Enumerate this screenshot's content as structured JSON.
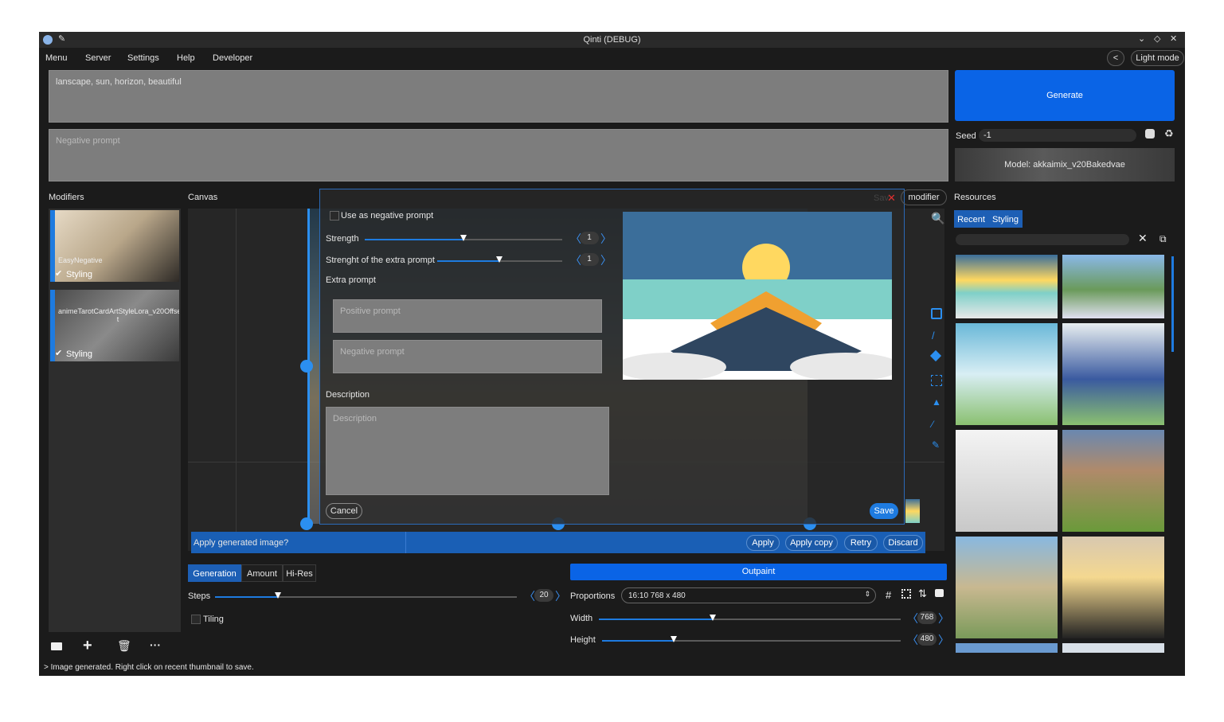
{
  "window": {
    "title": "Qinti (DEBUG)"
  },
  "menu": {
    "items": [
      "Menu",
      "Server",
      "Settings",
      "Help",
      "Developer"
    ],
    "back_label": "<",
    "mode_label": "Light mode"
  },
  "prompt": {
    "value": "lanscape, sun, horizon, beautiful",
    "negative_placeholder": "Negative prompt"
  },
  "generate": {
    "label": "Generate"
  },
  "seed": {
    "label": "Seed",
    "value": "-1"
  },
  "model": {
    "label": "Model: akkaimix_v20Bakedvae"
  },
  "sections": {
    "modifiers": "Modifiers",
    "canvas": "Canvas",
    "resources": "Resources"
  },
  "modifiers": [
    {
      "name": "EasyNegative",
      "tag": "Styling",
      "checked": true
    },
    {
      "name": "animeTarotCardArtStyleLora_v20Offse\nt",
      "tag": "Styling",
      "checked": true
    }
  ],
  "modifier_toolbar": [
    "folder-icon",
    "add-icon",
    "trash-icon",
    "more-icon"
  ],
  "dialog": {
    "use_negative": "Use as negative prompt",
    "strength_label": "Strength",
    "strength_value": "1",
    "strength_fraction": 0.5,
    "extra_strength_label": "Strenght of the extra prompt",
    "extra_strength_value": "1",
    "extra_strength_fraction": 0.5,
    "extra_prompt_label": "Extra prompt",
    "positive_placeholder": "Positive prompt",
    "negative_placeholder": "Negative prompt",
    "description_label": "Description",
    "description_placeholder": "Description",
    "cancel": "Cancel",
    "save": "Save",
    "header_right": "modifier",
    "header_hidden": "Sav"
  },
  "apply_bar": {
    "question": "Apply generated image?",
    "apply": "Apply",
    "apply_copy": "Apply copy",
    "retry": "Retry",
    "discard": "Discard"
  },
  "bottom_tabs": [
    "Generation",
    "Amount",
    "Hi-Res"
  ],
  "steps": {
    "label": "Steps",
    "value": "20",
    "fraction": 0.21
  },
  "tiling": {
    "label": "Tiling"
  },
  "outpaint": {
    "label": "Outpaint"
  },
  "proportions": {
    "label": "Proportions",
    "value": "16:10 768 x 480"
  },
  "width": {
    "label": "Width",
    "value": "768",
    "fraction": 0.38
  },
  "height": {
    "label": "Height",
    "value": "480",
    "fraction": 0.24
  },
  "resources": {
    "tabs": [
      "Recent",
      "Styling"
    ]
  },
  "status": "> Image generated. Right click on recent thumbnail to save."
}
